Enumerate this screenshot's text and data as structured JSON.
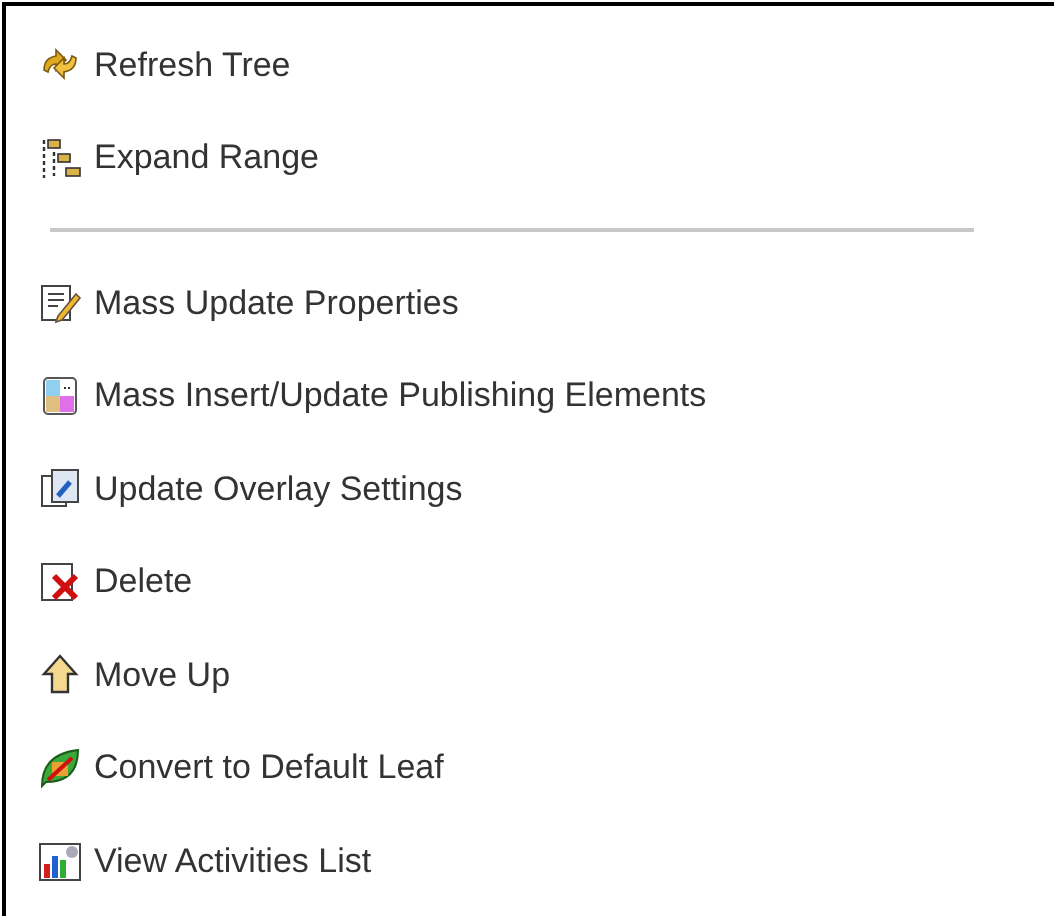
{
  "menu": {
    "items": [
      {
        "kind": "action",
        "label": "Refresh Tree"
      },
      {
        "kind": "action",
        "label": "Expand Range"
      },
      {
        "kind": "separator"
      },
      {
        "kind": "action",
        "label": "Mass Update Properties"
      },
      {
        "kind": "action",
        "label": "Mass Insert/Update Publishing Elements"
      },
      {
        "kind": "action",
        "label": "Update Overlay Settings"
      },
      {
        "kind": "action",
        "label": "Delete"
      },
      {
        "kind": "action",
        "label": "Move Up"
      },
      {
        "kind": "action",
        "label": "Convert to Default Leaf"
      },
      {
        "kind": "action",
        "label": "View Activities List"
      }
    ]
  }
}
